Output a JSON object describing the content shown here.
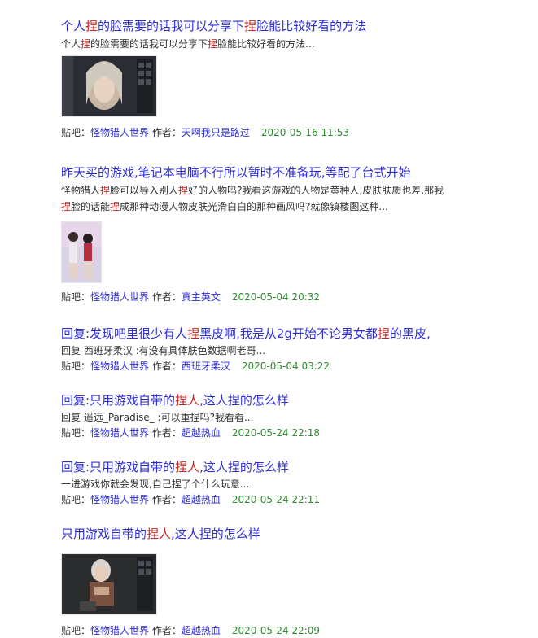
{
  "labels": {
    "forum_prefix": "贴吧：",
    "author_prefix": "作者："
  },
  "results": [
    {
      "title": [
        "个人",
        "捏",
        "的脸需要的话我可以分享下",
        "捏",
        "脸能比较好看的方法"
      ],
      "abstract_line1": [
        "个人",
        "捏",
        "的脸需要的话我可以分享下",
        "捏",
        "脸能比较好看的方法..."
      ],
      "forum": "怪物猎人世界",
      "author": "天啊我只是路过",
      "date": "2020-05-16 11:53"
    },
    {
      "title": [
        "昨天买的游戏,笔记本电脑不行所以暂时不准备玩,等配了台式开始"
      ],
      "abstract_line1": [
        "怪物猎人",
        "捏",
        "脸可以导入别人",
        "捏",
        "好的人物吗?我看这游戏的人物是黄种人,皮肤肤质也差,那我"
      ],
      "abstract_line2": [
        "捏",
        "脸的话能",
        "捏",
        "成那种动漫人物皮肤光滑白白的那种画风吗?就像镇楼图这种..."
      ],
      "forum": "怪物猎人世界",
      "author": "真主英文",
      "date": "2020-05-04 20:32"
    },
    {
      "title": [
        "回复:发现吧里很少有人",
        "捏",
        "黑皮啊,我是从2g开始不论男女都",
        "捏",
        "的黑皮,"
      ],
      "abstract_line1": [
        "回复 西班牙柔汉 :有没有具体肤色数据啊老哥..."
      ],
      "forum": "怪物猎人世界",
      "author": "西班牙柔汉",
      "date": "2020-05-04 03:22"
    },
    {
      "title": [
        "回复:只用游戏自带的",
        "捏人",
        ",这人捏的怎么样"
      ],
      "abstract_line1": [
        "回复 遥远_Paradise_ :可以重捏吗?我看看..."
      ],
      "forum": "怪物猎人世界",
      "author": "超越热血",
      "date": "2020-05-24 22:18"
    },
    {
      "title": [
        "回复:只用游戏自带的",
        "捏人",
        ",这人捏的怎么样"
      ],
      "abstract_line1": [
        "一进游戏你就会发现,自己捏了个什么玩意..."
      ],
      "forum": "怪物猎人世界",
      "author": "超越热血",
      "date": "2020-05-24 22:11"
    },
    {
      "title": [
        "只用游戏自带的",
        "捏人",
        ",这人捏的怎么样"
      ],
      "forum": "怪物猎人世界",
      "author": "超越热血",
      "date": "2020-05-24 22:09"
    }
  ]
}
